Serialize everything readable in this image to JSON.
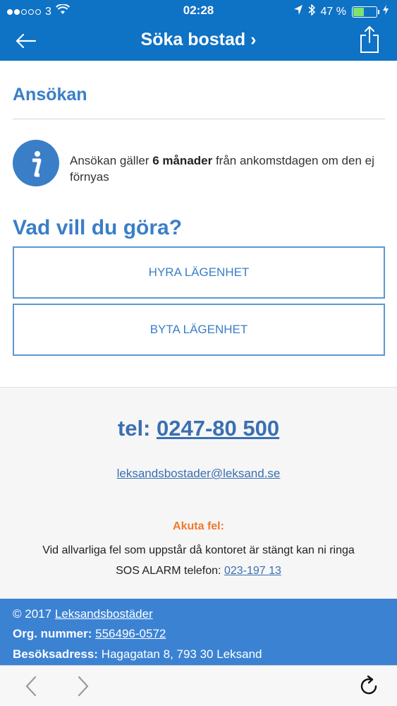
{
  "status_bar": {
    "carrier": "3",
    "time": "02:28",
    "battery": "47 %",
    "battery_level": 0.47,
    "icons": [
      "signal-dots",
      "wifi-icon",
      "location-icon",
      "bluetooth-icon",
      "battery-icon",
      "charging-icon"
    ]
  },
  "nav": {
    "title": "Söka bostad ›",
    "back_icon": "arrow-left-icon",
    "share_icon": "share-icon"
  },
  "main": {
    "section_title": "Ansökan",
    "info": {
      "pre": "Ansökan gäller ",
      "bold": "6 månader",
      "post": " från ankomstdagen om den ej förnyas"
    },
    "question": "Vad vill du göra?",
    "options": [
      "HYRA LÄGENHET",
      "BYTA LÄGENHET"
    ]
  },
  "contact": {
    "tel_label": "tel:",
    "tel_number": "0247-80 500",
    "email": "leksandsbostader@leksand.se",
    "akuta_title": "Akuta fel:",
    "akuta_line1": "Vid allvarliga fel som uppstår då kontoret är stängt kan ni ringa",
    "akuta_line2_pre": "SOS ALARM telefon:",
    "akuta_phone": "023-197 13"
  },
  "footer": {
    "copyright": "© 2017",
    "company": "Leksandsbostäder",
    "org_label": "Org. nummer:",
    "org_number": "556496-0572",
    "address_label": "Besöksadress:",
    "address": "Hagagatan 8, 793 30 Leksand"
  },
  "colors": {
    "brand_blue": "#0e72c5",
    "accent_blue": "#3a7ec7",
    "footer_blue": "#3b82d3",
    "alert_orange": "#ef7a2a"
  }
}
